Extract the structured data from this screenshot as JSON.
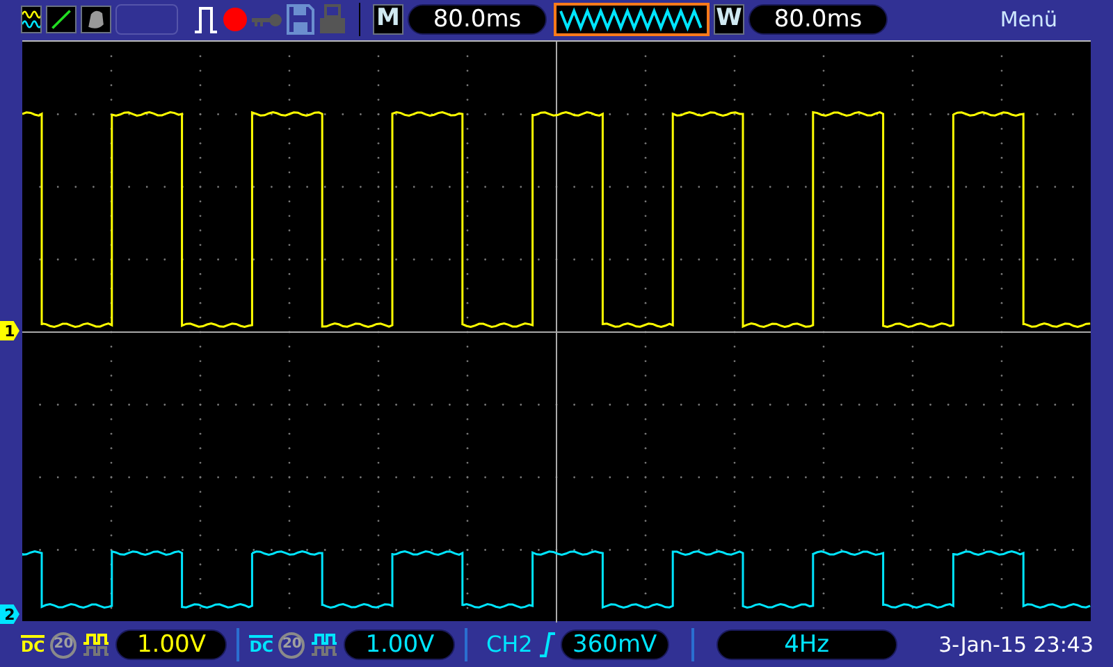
{
  "toolbar": {
    "m_label": "M",
    "timebase": "80.0ms",
    "w_label": "W",
    "window_time": "80.0ms",
    "menu": "Menü"
  },
  "channels": [
    {
      "marker": "1",
      "color": "#ffff00",
      "coupling": "DC",
      "bw_label": "20",
      "scale": "1.00V"
    },
    {
      "marker": "2",
      "color": "#00e5ff",
      "coupling": "DC",
      "bw_label": "20",
      "scale": "1.00V"
    }
  ],
  "trigger": {
    "source": "CH2",
    "level": "360mV"
  },
  "frequency": "4Hz",
  "datetime": "3-Jan-15 23:43"
}
